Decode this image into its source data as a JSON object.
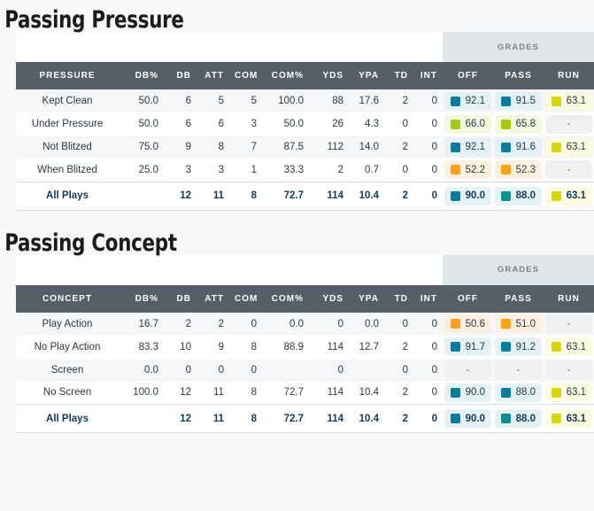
{
  "page": {
    "background": "#f7f8f9"
  },
  "grade_colors": {
    "elite": "#0b7c9c",
    "elite_teal": "#0f8f8f",
    "green": "#a8c811",
    "yellow": "#d8d50a",
    "orange": "#fba119",
    "header_bar": "#565e68",
    "grades_band": "#e2e5e9",
    "total_text": "#123a5e"
  },
  "sections": [
    {
      "title": "Passing Pressure",
      "group_header": "GRADES",
      "columns": [
        "PRESSURE",
        "DB%",
        "DB",
        "ATT",
        "COM",
        "COM%",
        "YDS",
        "YPA",
        "TD",
        "INT",
        "OFF",
        "PASS",
        "RUN"
      ],
      "rows": [
        {
          "label": "Kept Clean",
          "cells": [
            "50.0",
            "6",
            "5",
            "5",
            "100.0",
            "88",
            "17.6",
            "2",
            "0"
          ],
          "grades": [
            {
              "value": "92.1",
              "tier": "elite"
            },
            {
              "value": "91.5",
              "tier": "elite"
            },
            {
              "value": "63.1",
              "tier": "yellow"
            }
          ]
        },
        {
          "label": "Under Pressure",
          "cells": [
            "50.0",
            "6",
            "6",
            "3",
            "50.0",
            "26",
            "4.3",
            "0",
            "0"
          ],
          "grades": [
            {
              "value": "66.0",
              "tier": "green"
            },
            {
              "value": "65.8",
              "tier": "green"
            },
            {
              "value": "-",
              "tier": "empty"
            }
          ]
        },
        {
          "label": "Not Blitzed",
          "cells": [
            "75.0",
            "9",
            "8",
            "7",
            "87.5",
            "112",
            "14.0",
            "2",
            "0"
          ],
          "grades": [
            {
              "value": "92.1",
              "tier": "elite"
            },
            {
              "value": "91.6",
              "tier": "elite"
            },
            {
              "value": "63.1",
              "tier": "yellow"
            }
          ]
        },
        {
          "label": "When Blitzed",
          "cells": [
            "25.0",
            "3",
            "3",
            "1",
            "33.3",
            "2",
            "0.7",
            "0",
            "0"
          ],
          "grades": [
            {
              "value": "52.2",
              "tier": "orange"
            },
            {
              "value": "52.3",
              "tier": "orange"
            },
            {
              "value": "-",
              "tier": "empty"
            }
          ]
        }
      ],
      "total": {
        "label": "All Plays",
        "cells": [
          "",
          "12",
          "11",
          "8",
          "72.7",
          "114",
          "10.4",
          "2",
          "0"
        ],
        "grades": [
          {
            "value": "90.0",
            "tier": "elite"
          },
          {
            "value": "88.0",
            "tier": "elite2"
          },
          {
            "value": "63.1",
            "tier": "yellow"
          }
        ]
      }
    },
    {
      "title": "Passing Concept",
      "group_header": "GRADES",
      "columns": [
        "CONCEPT",
        "DB%",
        "DB",
        "ATT",
        "COM",
        "COM%",
        "YDS",
        "YPA",
        "TD",
        "INT",
        "OFF",
        "PASS",
        "RUN"
      ],
      "rows": [
        {
          "label": "Play Action",
          "cells": [
            "16.7",
            "2",
            "2",
            "0",
            "0.0",
            "0",
            "0.0",
            "0",
            "0"
          ],
          "grades": [
            {
              "value": "50.6",
              "tier": "orange"
            },
            {
              "value": "51.0",
              "tier": "orange"
            },
            {
              "value": "-",
              "tier": "empty"
            }
          ]
        },
        {
          "label": "No Play Action",
          "cells": [
            "83.3",
            "10",
            "9",
            "8",
            "88.9",
            "114",
            "12.7",
            "2",
            "0"
          ],
          "grades": [
            {
              "value": "91.7",
              "tier": "elite"
            },
            {
              "value": "91.2",
              "tier": "elite"
            },
            {
              "value": "63.1",
              "tier": "yellow"
            }
          ]
        },
        {
          "label": "Screen",
          "cells": [
            "0.0",
            "0",
            "0",
            "0",
            "",
            "0",
            "",
            "0",
            "0"
          ],
          "grades": [
            {
              "value": "-",
              "tier": "empty"
            },
            {
              "value": "-",
              "tier": "empty"
            },
            {
              "value": "-",
              "tier": "empty"
            }
          ]
        },
        {
          "label": "No Screen",
          "cells": [
            "100.0",
            "12",
            "11",
            "8",
            "72.7",
            "114",
            "10.4",
            "2",
            "0"
          ],
          "grades": [
            {
              "value": "90.0",
              "tier": "elite"
            },
            {
              "value": "88.0",
              "tier": "elite"
            },
            {
              "value": "63.1",
              "tier": "yellow"
            }
          ]
        }
      ],
      "total": {
        "label": "All Plays",
        "cells": [
          "",
          "12",
          "11",
          "8",
          "72.7",
          "114",
          "10.4",
          "2",
          "0"
        ],
        "grades": [
          {
            "value": "90.0",
            "tier": "elite"
          },
          {
            "value": "88.0",
            "tier": "elite2"
          },
          {
            "value": "63.1",
            "tier": "yellow"
          }
        ]
      }
    }
  ]
}
